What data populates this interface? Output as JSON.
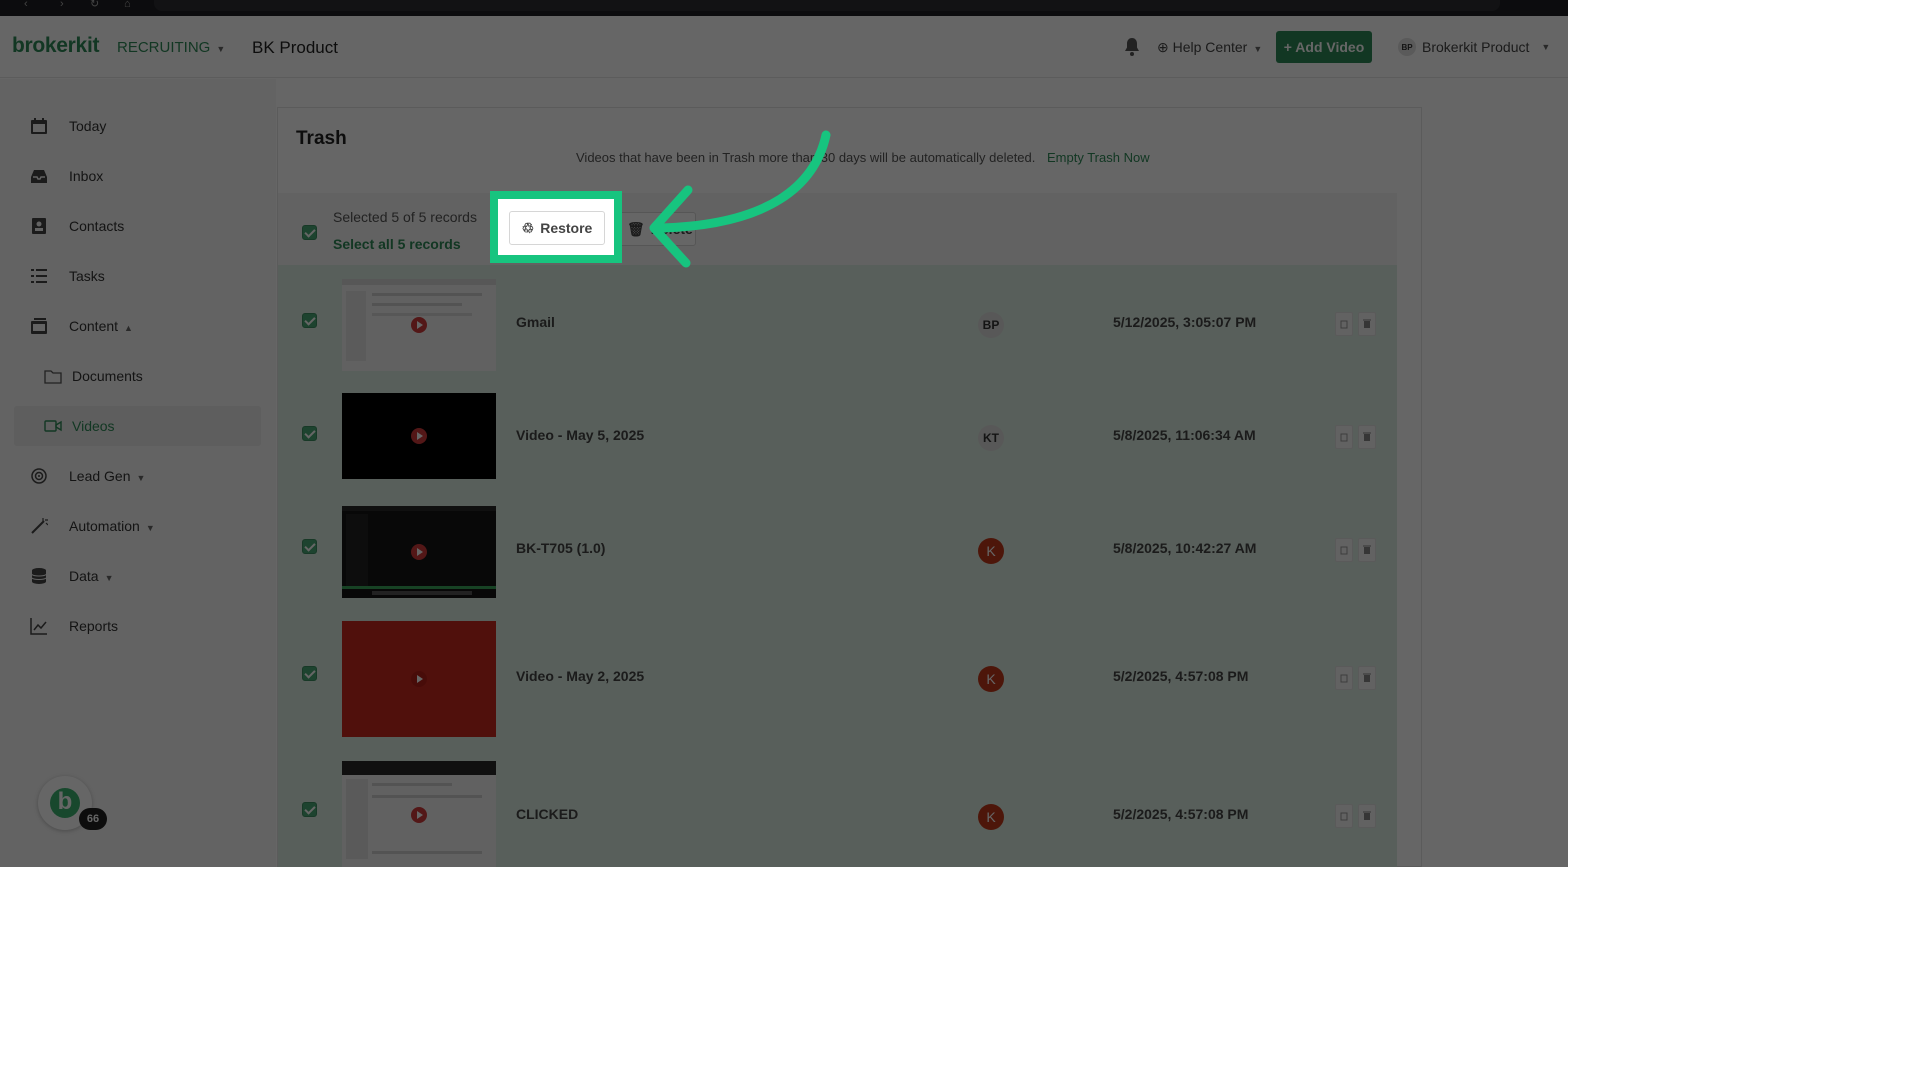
{
  "app": {
    "logo": "brokerkit",
    "module": "RECRUITING",
    "product": "BK Product",
    "help_center": "Help Center",
    "add_video": "+ Add Video",
    "user_initials": "BP",
    "user_name": "Brokerkit Product"
  },
  "sidebar": {
    "items": [
      {
        "label": "Today",
        "icon": "calendar-icon"
      },
      {
        "label": "Inbox",
        "icon": "inbox-icon"
      },
      {
        "label": "Contacts",
        "icon": "contacts-icon"
      },
      {
        "label": "Tasks",
        "icon": "tasks-icon"
      },
      {
        "label": "Content",
        "icon": "content-icon"
      },
      {
        "label": "Documents",
        "icon": "folder-icon"
      },
      {
        "label": "Videos",
        "icon": "video-icon"
      },
      {
        "label": "Lead Gen",
        "icon": "leadgen-icon"
      },
      {
        "label": "Automation",
        "icon": "wand-icon"
      },
      {
        "label": "Data",
        "icon": "database-icon"
      },
      {
        "label": "Reports",
        "icon": "chart-icon"
      }
    ],
    "active": "Videos",
    "chat_badge": "66",
    "chat_logo": "b"
  },
  "trash": {
    "title": "Trash",
    "notice": "Videos that have been in Trash more than 30 days will be automatically deleted.",
    "empty_link": "Empty Trash Now",
    "selected_text": "Selected 5 of 5 records",
    "select_all": "Select all 5 records",
    "restore_label": "Restore",
    "delete_label": "Delete",
    "rows": [
      {
        "name": "Gmail",
        "owner": "BP",
        "date": "5/12/2025, 3:05:07 PM"
      },
      {
        "name": "Video - May 5, 2025",
        "owner": "KT",
        "date": "5/8/2025, 11:06:34 AM"
      },
      {
        "name": "BK-T705 (1.0)",
        "owner": "K",
        "date": "5/8/2025, 10:42:27 AM"
      },
      {
        "name": "Video - May 2, 2025",
        "owner": "K",
        "date": "5/2/2025, 4:57:08 PM"
      },
      {
        "name": "CLICKED",
        "owner": "K",
        "date": "5/2/2025, 4:57:08 PM"
      }
    ]
  },
  "colors": {
    "brand": "#2e8b57",
    "highlight": "#17c47f",
    "owner_red": "#c0391b"
  }
}
